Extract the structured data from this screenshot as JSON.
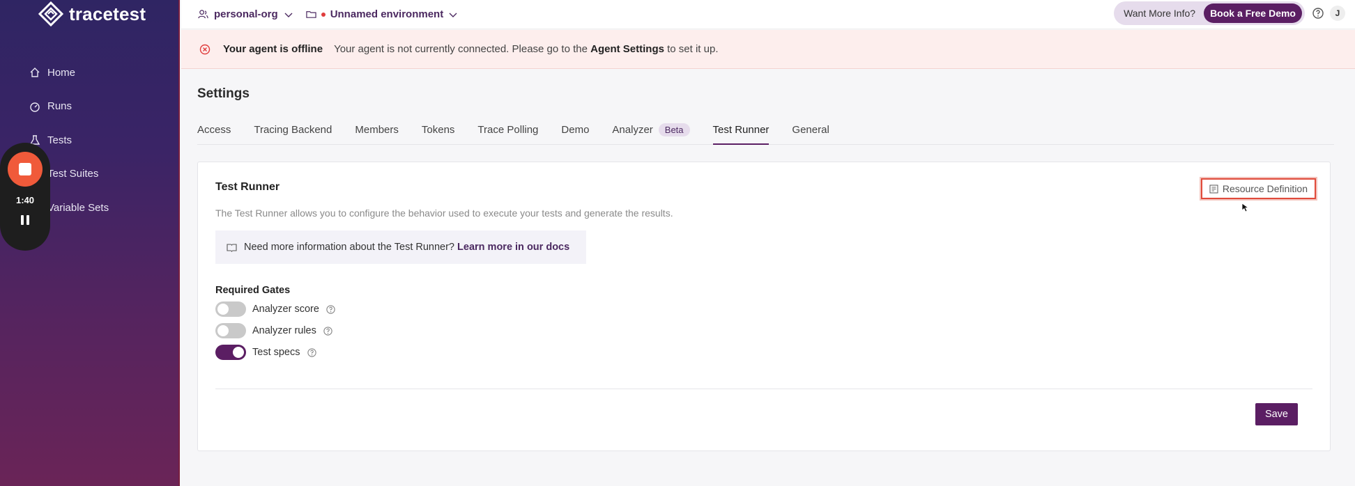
{
  "brand": {
    "name": "tracetest"
  },
  "sidebar": {
    "items": [
      {
        "label": "Home",
        "icon": "home-icon"
      },
      {
        "label": "Runs",
        "icon": "gauge-icon"
      },
      {
        "label": "Tests",
        "icon": "flask-icon"
      },
      {
        "label": "Test Suites",
        "icon": "suites-icon"
      },
      {
        "label": "Variable Sets",
        "icon": "variables-icon"
      }
    ]
  },
  "recorder": {
    "time": "1:40"
  },
  "topbar": {
    "org": "personal-org",
    "environment": "Unnamed environment",
    "promo_question": "Want More Info?",
    "promo_button": "Book a Free Demo",
    "avatar_initial": "J"
  },
  "banner": {
    "title": "Your agent is offline",
    "message_pre": "Your agent is not currently connected. Please go to the ",
    "message_link": "Agent Settings",
    "message_post": " to set it up."
  },
  "main": {
    "title": "Settings",
    "tabs": [
      {
        "label": "Access"
      },
      {
        "label": "Tracing Backend"
      },
      {
        "label": "Members"
      },
      {
        "label": "Tokens"
      },
      {
        "label": "Trace Polling"
      },
      {
        "label": "Demo"
      },
      {
        "label": "Analyzer",
        "badge": "Beta"
      },
      {
        "label": "Test Runner",
        "active": true
      },
      {
        "label": "General"
      }
    ]
  },
  "card": {
    "title": "Test Runner",
    "resource_button": "Resource Definition",
    "description": "The Test Runner allows you to configure the behavior used to execute your tests and generate the results.",
    "info_text": "Need more information about the Test Runner?",
    "info_link": "Learn more in our docs",
    "gates_title": "Required Gates",
    "gates": [
      {
        "label": "Analyzer score",
        "enabled": false
      },
      {
        "label": "Analyzer rules",
        "enabled": false
      },
      {
        "label": "Test specs",
        "enabled": true
      }
    ],
    "save_label": "Save"
  },
  "colors": {
    "accent": "#5b1e63",
    "alert": "#e03c3c",
    "banner_bg": "#fdeeed"
  }
}
